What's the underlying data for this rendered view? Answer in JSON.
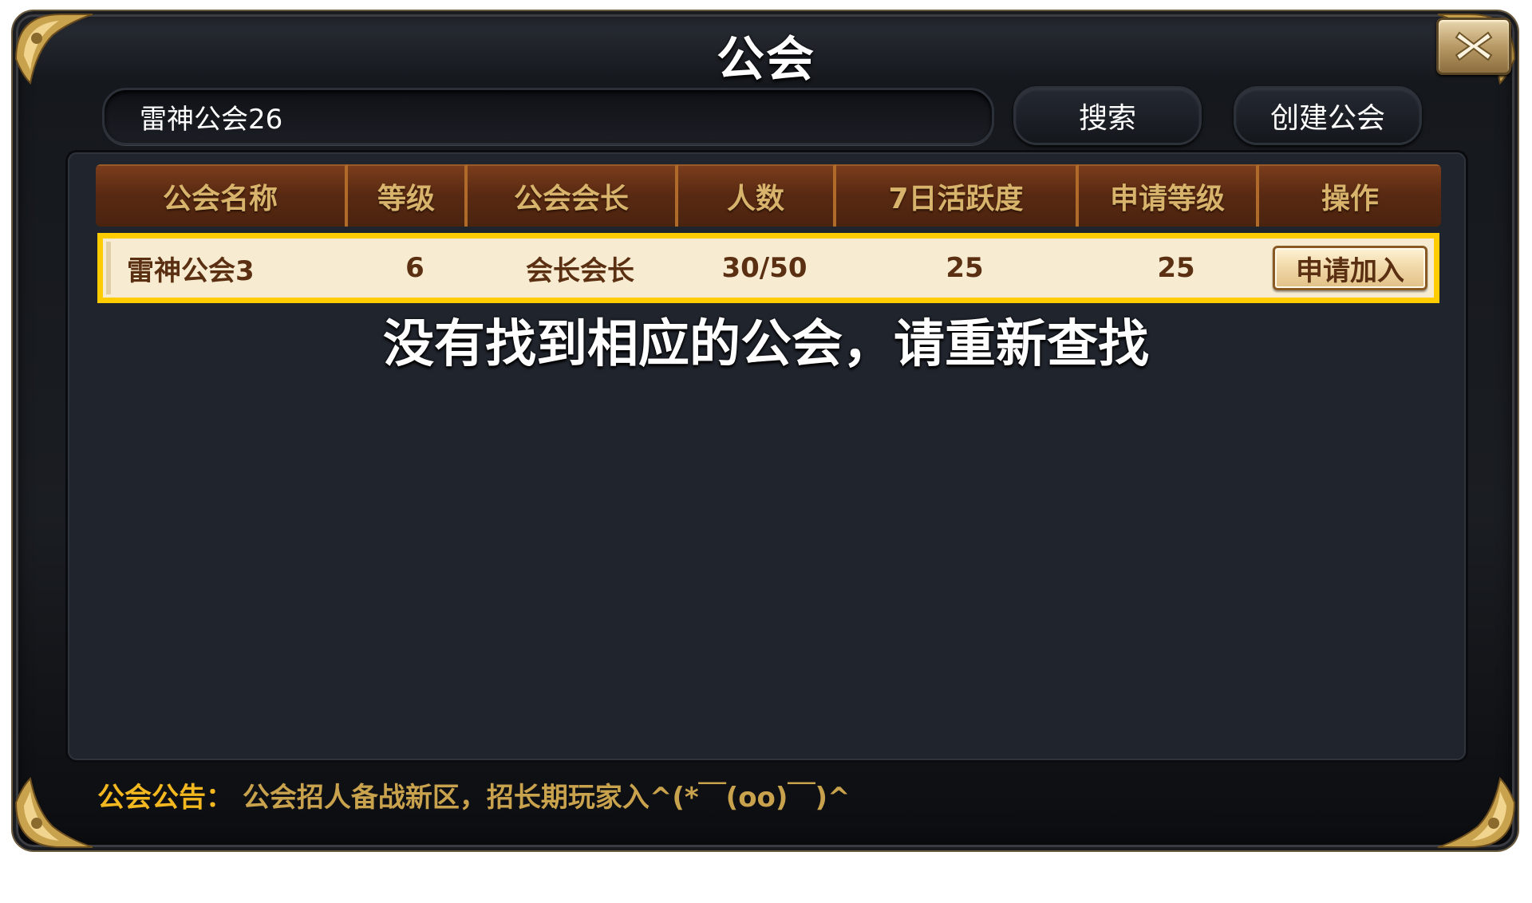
{
  "dialog": {
    "title": "公会"
  },
  "search": {
    "value": "雷神公会26",
    "search_label": "搜索",
    "create_label": "创建公会"
  },
  "table": {
    "columns": [
      "公会名称",
      "等级",
      "公会会长",
      "人数",
      "7日活跃度",
      "申请等级",
      "操作"
    ],
    "rows": [
      {
        "name": "雷神公会3",
        "level": "6",
        "leader": "会长会长",
        "members": "30/50",
        "activity": "25",
        "apply_level": "25",
        "action": "申请加入"
      }
    ]
  },
  "message": "没有找到相应的公会，请重新查找",
  "notice": {
    "label": "公会公告：",
    "text": "公会招人备战新区，招长期玩家入^(*￣(oo)￣)^"
  },
  "colors": {
    "header_text": "#d8b36c",
    "row_highlight": "#ffcc00",
    "row_text": "#5b3012",
    "notice_label": "#f3b820",
    "notice_text": "#c9a24e"
  },
  "icons": {
    "close": "close-icon"
  }
}
